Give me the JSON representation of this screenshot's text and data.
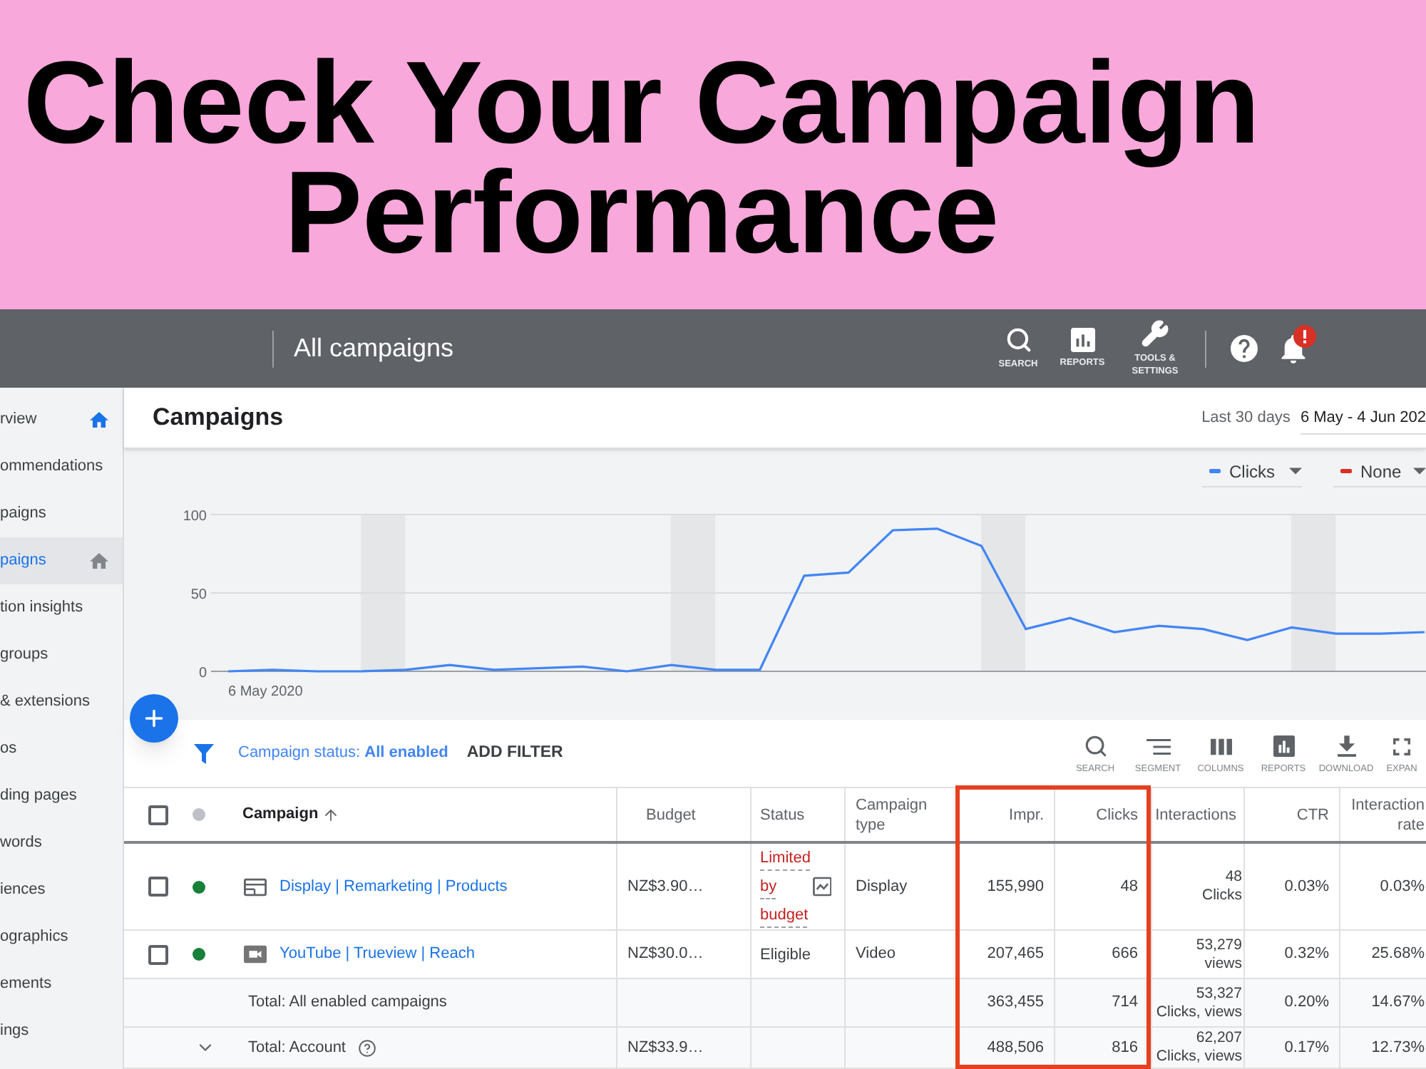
{
  "banner": {
    "headline": "Check Your Campaign Performance"
  },
  "top_bar": {
    "title": "All campaigns",
    "tools": [
      {
        "kind": "search",
        "label": "SEARCH"
      },
      {
        "kind": "reports",
        "label": "REPORTS"
      },
      {
        "kind": "tools",
        "label": "TOOLS & SETTINGS"
      }
    ],
    "notifications": {
      "alert": true
    }
  },
  "sidebar": {
    "items": [
      {
        "label": "rview",
        "selected": false,
        "home_icon": true
      },
      {
        "label": "ommendations",
        "selected": false,
        "home_icon": false
      },
      {
        "label": "paigns",
        "selected": false,
        "home_icon": false
      },
      {
        "label": "paigns",
        "selected": true,
        "home_icon": true
      },
      {
        "label": "tion insights",
        "selected": false,
        "home_icon": false
      },
      {
        "label": "groups",
        "selected": false,
        "home_icon": false
      },
      {
        "label": "& extensions",
        "selected": false,
        "home_icon": false
      },
      {
        "label": "os",
        "selected": false,
        "home_icon": false
      },
      {
        "label": "ding pages",
        "selected": false,
        "home_icon": false
      },
      {
        "label": "words",
        "selected": false,
        "home_icon": false
      },
      {
        "label": "iences",
        "selected": false,
        "home_icon": false
      },
      {
        "label": "ographics",
        "selected": false,
        "home_icon": false
      },
      {
        "label": "ements",
        "selected": false,
        "home_icon": false
      },
      {
        "label": "ings",
        "selected": false,
        "home_icon": false
      }
    ]
  },
  "page": {
    "title": "Campaigns",
    "date_range": {
      "label": "Last 30 days",
      "value": "6 May - 4 Jun 202"
    }
  },
  "chart": {
    "second_metric": {
      "label": "None",
      "color": "#d93025"
    },
    "chart_data": {
      "type": "line",
      "ylim": [
        0,
        100
      ],
      "yticks": [
        0,
        50,
        100
      ],
      "series": [
        {
          "name": "Clicks",
          "color": "#4285f4",
          "values": [
            0,
            1,
            0,
            0,
            1,
            4,
            1,
            2,
            3,
            0,
            4,
            1,
            1,
            61,
            63,
            90,
            91,
            80,
            27,
            34,
            25,
            29,
            27,
            20,
            28,
            24,
            24,
            25
          ]
        }
      ],
      "annotations": [
        "6 May 2020"
      ]
    }
  },
  "toolbar": {
    "filter": "Campaign status: **All enabled**",
    "add_filter": "ADD FILTER",
    "actions": [
      {
        "kind": "search",
        "label": "SEARCH"
      },
      {
        "kind": "segment",
        "label": "SEGMENT"
      },
      {
        "kind": "columns",
        "label": "COLUMNS"
      },
      {
        "kind": "reports",
        "label": "REPORTS"
      },
      {
        "kind": "download",
        "label": "DOWNLOAD"
      },
      {
        "kind": "expand",
        "label": "EXPAN"
      }
    ]
  },
  "table": {
    "select_all": {
      "checked": false
    },
    "columns": [
      {
        "label": "Campaign",
        "sorted": true,
        "highlighted": false
      },
      {
        "label": "Budget",
        "sorted": false,
        "highlighted": false
      },
      {
        "label": "Status",
        "sorted": false,
        "highlighted": false
      },
      {
        "label": "Campaign type",
        "sorted": false,
        "highlighted": false
      },
      {
        "label": "Impr.",
        "sorted": false,
        "highlighted": true
      },
      {
        "label": "Clicks",
        "sorted": false,
        "highlighted": true
      },
      {
        "label": "Interactions",
        "sorted": false,
        "highlighted": false
      },
      {
        "label": "CTR",
        "sorted": false,
        "highlighted": false
      },
      {
        "label": "Interaction rate",
        "sorted": false,
        "highlighted": false
      }
    ],
    "rows": [
      {
        "kind": "campaign",
        "checked": false,
        "color": "#188038",
        "channel": {
          "kind": "display"
        },
        "name": "Display | Remarketing | Products",
        "budget": "NZ$3.90…",
        "status": {
          "text": "Limited by budget",
          "limited": true
        },
        "type": "Display",
        "impr": "155,990",
        "clicks": "48",
        "interactions": {
          "value": "48",
          "unit": "Clicks"
        },
        "ctr": "0.03%",
        "rate": "0.03%"
      },
      {
        "kind": "campaign",
        "checked": false,
        "color": "#188038",
        "channel": {
          "kind": "video"
        },
        "name": "YouTube | Trueview | Reach",
        "budget": "NZ$30.0…",
        "status": {
          "text": "Eligible",
          "limited": false
        },
        "type": "Video",
        "impr": "207,465",
        "clicks": "666",
        "interactions": {
          "value": "53,279",
          "unit": "views"
        },
        "ctr": "0.32%",
        "rate": "25.68%"
      },
      {
        "kind": "total",
        "label": "Total: All enabled campaigns",
        "impr": "363,455",
        "clicks": "714",
        "interactions": {
          "value": "53,327",
          "unit": "Clicks, views"
        },
        "ctr": "0.20%",
        "rate": "14.67%"
      },
      {
        "kind": "account_total",
        "expanded": false,
        "label": "Total: Account",
        "budget": "NZ$33.9…",
        "impr": "488,506",
        "clicks": "816",
        "interactions": {
          "value": "62,207",
          "unit": "Clicks, views"
        },
        "ctr": "0.17%",
        "rate": "12.73%"
      }
    ]
  }
}
